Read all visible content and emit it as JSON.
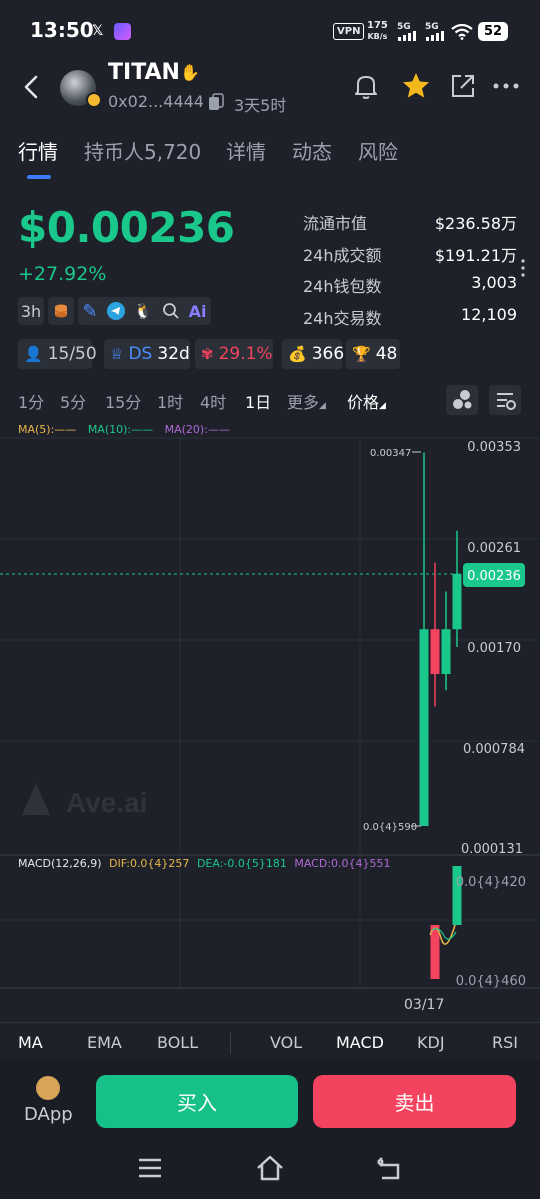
{
  "status_bar": {
    "time": "13:50",
    "vpn": "VPN",
    "speed_value": "175",
    "speed_unit": "KB/s",
    "signal1": "5G",
    "signal2": "5G",
    "battery": "52"
  },
  "header": {
    "token_name": "TITAN",
    "address": "0x02...4444",
    "age": "3天5时"
  },
  "tabs": [
    "行情",
    "持币人5,720",
    "详情",
    "动态",
    "风险"
  ],
  "price": {
    "value": "$0.00236",
    "change": "+27.92%",
    "color": "#19c88a"
  },
  "stats": [
    {
      "label": "流通市值",
      "value": "$236.58万"
    },
    {
      "label": "24h成交额",
      "value": "$191.21万"
    },
    {
      "label": "24h钱包数",
      "value": "3,003"
    },
    {
      "label": "24h交易数",
      "value": "12,109"
    }
  ],
  "chips": {
    "age": "3h",
    "holders_ratio": "15/50",
    "ds_label": "DS",
    "ds_age": "32d",
    "concentration": "29.1%",
    "money_count": "366",
    "trophy_count": "48"
  },
  "intervals": [
    "1分",
    "5分",
    "15分",
    "1时",
    "4时",
    "1日",
    "更多",
    "价格"
  ],
  "active_interval": "1日",
  "chart_data": {
    "type": "candlestick",
    "ma_legend": [
      "MA(5):——",
      "MA(10):——",
      "MA(20):——"
    ],
    "y_ticks": [
      "0.00353",
      "0.00261",
      "0.00170",
      "0.000784",
      "0.000131"
    ],
    "current_price_label": "0.00236",
    "high_label": "0.00347",
    "low_label": "0.0{4}590",
    "candles": [
      {
        "open": 5.9e-05,
        "high": 0.00347,
        "low": 5.9e-05,
        "close": 0.00186,
        "dir": "up"
      },
      {
        "open": 0.00186,
        "high": 0.00246,
        "low": 0.00115,
        "close": 0.00145,
        "dir": "down"
      },
      {
        "open": 0.00145,
        "high": 0.0022,
        "low": 0.0013,
        "close": 0.00186,
        "dir": "up"
      },
      {
        "open": 0.00186,
        "high": 0.00275,
        "low": 0.0017,
        "close": 0.00236,
        "dir": "up"
      }
    ],
    "x_label": "03/17",
    "watermark": "Ave.ai",
    "macd_legend": {
      "name": "MACD(12,26,9)",
      "dif": "DIF:0.0{4}257",
      "dea": "DEA:-0.0{5}181",
      "macd": "MACD:0.0{4}551"
    },
    "macd_ticks": [
      "0.0{4}420",
      "0.0{4}460"
    ],
    "colors": {
      "up": "#19c88a",
      "down": "#f4435e",
      "dif": "#e9b64a",
      "dea": "#19c88a",
      "macd": "#b06ad4",
      "ma5": "#e9b64a",
      "ma10": "#19c88a",
      "ma20": "#b06ad4"
    }
  },
  "indicators": [
    "MA",
    "EMA",
    "BOLL",
    "VOL",
    "MACD",
    "KDJ",
    "RSI"
  ],
  "active_indicators": [
    "MA",
    "MACD"
  ],
  "actions": {
    "dapp": "DApp",
    "buy": "买入",
    "sell": "卖出"
  }
}
